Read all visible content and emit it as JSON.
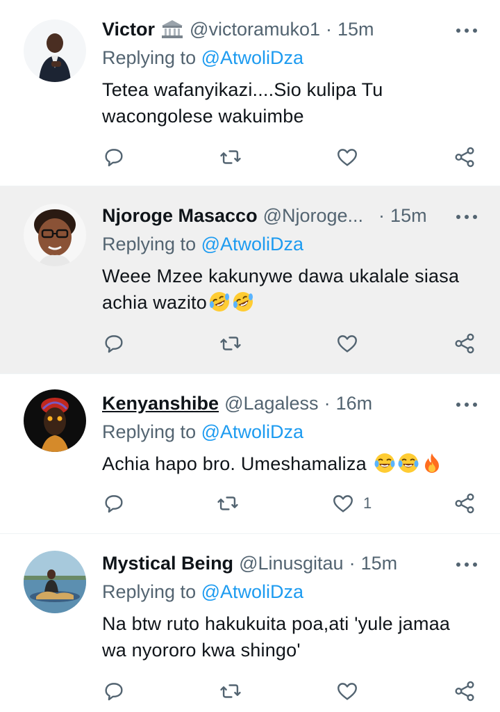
{
  "tweets": [
    {
      "name": "Victor",
      "has_badge": true,
      "badge_icon": "building-icon",
      "handle": "@victoramuko1",
      "time": "15m",
      "reply_prefix": "Replying to",
      "reply_to": "@AtwoliDza",
      "text": "Tetea wafanyikazi....Sio kulipa Tu\nwacongolese wakuimbe",
      "like_count": ""
    },
    {
      "name": "Njoroge Masacco",
      "handle": "@Njoroge...",
      "time": "15m",
      "reply_prefix": "Replying to",
      "reply_to": "@AtwoliDza",
      "text": "Weee Mzee kakunywe dawa ukalale siasa\nachia wazito",
      "emojis": [
        "rolling-laughing-emoji",
        "rolling-laughing-emoji"
      ],
      "like_count": ""
    },
    {
      "name": "Kenyanshibe",
      "handle": "@Lagaless",
      "time": "16m",
      "reply_prefix": "Replying to",
      "reply_to": "@AtwoliDza",
      "text": "Achia hapo bro. Umeshamaliza ",
      "emojis": [
        "tears-of-joy-emoji",
        "tears-of-joy-emoji",
        "fire-emoji"
      ],
      "like_count": "1"
    },
    {
      "name": "Mystical Being",
      "handle": "@Linusgitau",
      "time": "15m",
      "reply_prefix": "Replying to",
      "reply_to": "@AtwoliDza",
      "text": "Na btw ruto hakukuita poa,ati 'yule jamaa\nwa nyororo kwa shingo'",
      "like_count": ""
    }
  ],
  "colors": {
    "accent": "#1d9bf0",
    "secondary_text": "#536471",
    "highlight_bg": "#f0f0f0"
  },
  "icons": [
    "comment-icon",
    "retweet-icon",
    "like-icon",
    "share-icon",
    "more-icon"
  ]
}
